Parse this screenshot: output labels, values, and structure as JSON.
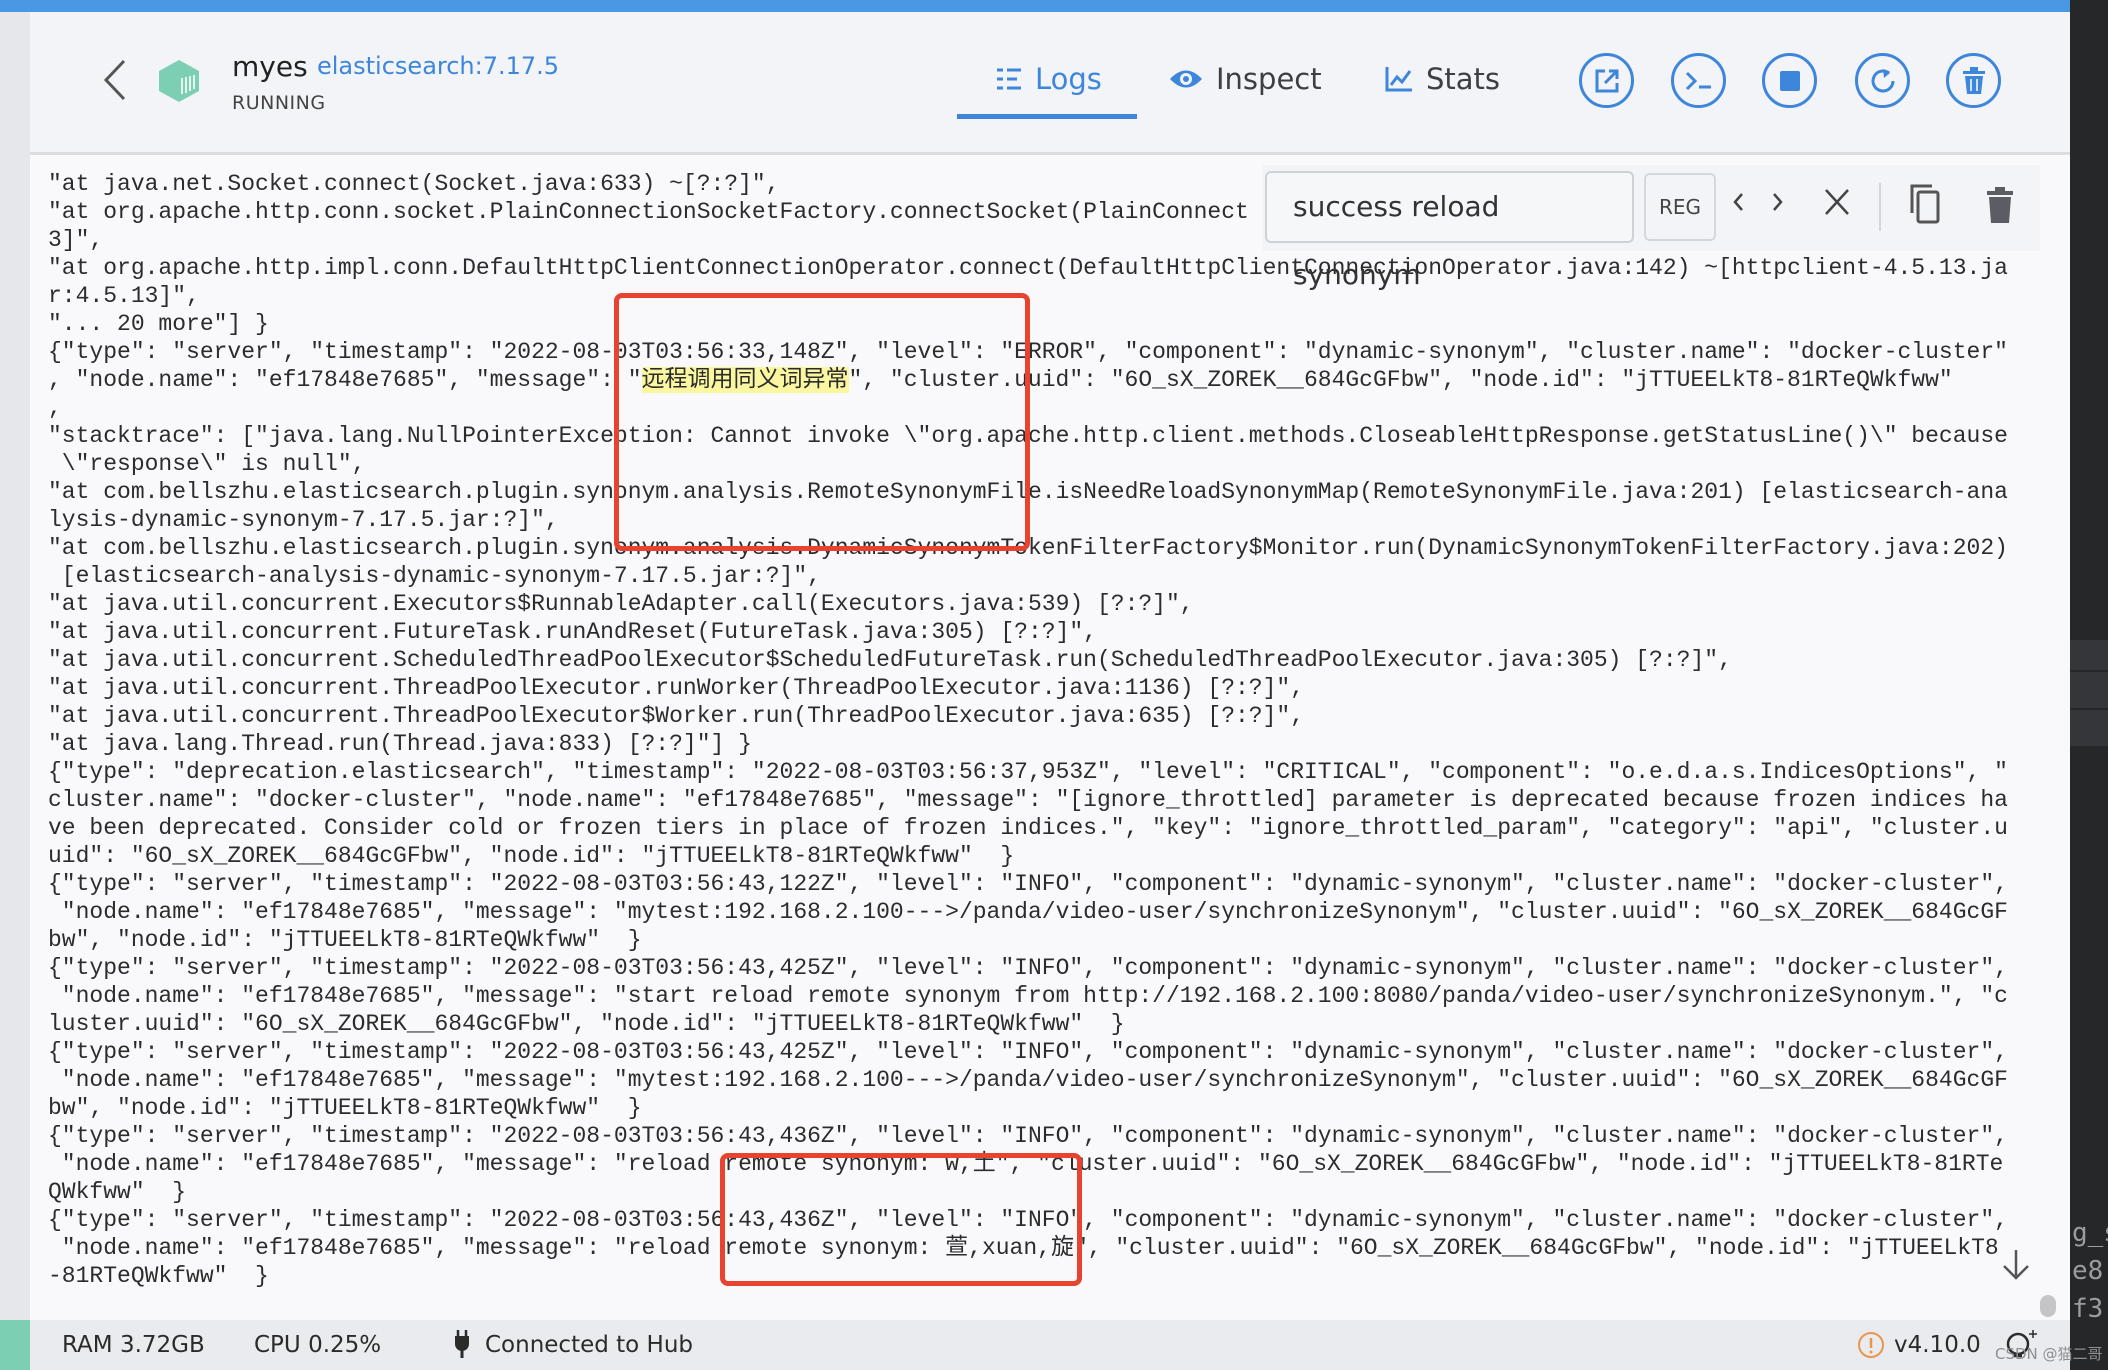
{
  "header": {
    "container_name": "myes",
    "image": "elasticsearch:7.17.5",
    "status": "RUNNING",
    "tabs": [
      {
        "label": "Logs",
        "icon": "list-icon",
        "active": true
      },
      {
        "label": "Inspect",
        "icon": "eye-icon",
        "active": false
      },
      {
        "label": "Stats",
        "icon": "chart-icon",
        "active": false
      }
    ],
    "actions": [
      "open-in-browser",
      "cli",
      "stop",
      "restart",
      "delete"
    ]
  },
  "search": {
    "query": "success reload synonym",
    "regex_label": "REG"
  },
  "logs": [
    {
      "t": "\"at java.net.Socket.connect(Socket.java:633) ~[?:?]\","
    },
    {
      "t": "\"at org.apache.http.conn.socket.PlainConnectionSocketFactory.connectSocket(PlainConnect"
    },
    {
      "t": "3]\","
    },
    {
      "t": "\"at org.apache.http.impl.conn.DefaultHttpClientConnectionOperator.connect(DefaultHttpClientConnectionOperator.java:142) ~[httpclient-4.5.13.ja"
    },
    {
      "t": "r:4.5.13]\","
    },
    {
      "t": "\"... 20 more\"] }"
    },
    {
      "t": "{\"type\": \"server\", \"timestamp\": \"2022-08-03T03:56:33,148Z\", \"level\": \"ERROR\", \"component\": \"dynamic-synonym\", \"cluster.name\": \"docker-cluster\""
    },
    {
      "t": ", \"node.name\": \"ef17848e7685\", \"message\": \"",
      "hl": "远程调用同义词异常",
      "t2": "\", \"cluster.uuid\": \"6O_sX_ZOREK__684GcGFbw\", \"node.id\": \"jTTUEELkT8-81RTeQWkfww\""
    },
    {
      "t": ","
    },
    {
      "t": "\"stacktrace\": [\"java.lang.NullPointerException: Cannot invoke \\\"org.apache.http.client.methods.CloseableHttpResponse.getStatusLine()\\\" because"
    },
    {
      "t": " \\\"response\\\" is null\","
    },
    {
      "t": "\"at com.bellszhu.elasticsearch.plugin.synonym.analysis.RemoteSynonymFile.isNeedReloadSynonymMap(RemoteSynonymFile.java:201) [elasticsearch-ana"
    },
    {
      "t": "lysis-dynamic-synonym-7.17.5.jar:?]\","
    },
    {
      "t": "\"at com.bellszhu.elasticsearch.plugin.synonym.analysis.DynamicSynonymTokenFilterFactory$Monitor.run(DynamicSynonymTokenFilterFactory.java:202)"
    },
    {
      "t": " [elasticsearch-analysis-dynamic-synonym-7.17.5.jar:?]\","
    },
    {
      "t": "\"at java.util.concurrent.Executors$RunnableAdapter.call(Executors.java:539) [?:?]\","
    },
    {
      "t": "\"at java.util.concurrent.FutureTask.runAndReset(FutureTask.java:305) [?:?]\","
    },
    {
      "t": "\"at java.util.concurrent.ScheduledThreadPoolExecutor$ScheduledFutureTask.run(ScheduledThreadPoolExecutor.java:305) [?:?]\","
    },
    {
      "t": "\"at java.util.concurrent.ThreadPoolExecutor.runWorker(ThreadPoolExecutor.java:1136) [?:?]\","
    },
    {
      "t": "\"at java.util.concurrent.ThreadPoolExecutor$Worker.run(ThreadPoolExecutor.java:635) [?:?]\","
    },
    {
      "t": "\"at java.lang.Thread.run(Thread.java:833) [?:?]\"] }"
    },
    {
      "t": "{\"type\": \"deprecation.elasticsearch\", \"timestamp\": \"2022-08-03T03:56:37,953Z\", \"level\": \"CRITICAL\", \"component\": \"o.e.d.a.s.IndicesOptions\", \""
    },
    {
      "t": "cluster.name\": \"docker-cluster\", \"node.name\": \"ef17848e7685\", \"message\": \"[ignore_throttled] parameter is deprecated because frozen indices ha"
    },
    {
      "t": "ve been deprecated. Consider cold or frozen tiers in place of frozen indices.\", \"key\": \"ignore_throttled_param\", \"category\": \"api\", \"cluster.u"
    },
    {
      "t": "uid\": \"6O_sX_ZOREK__684GcGFbw\", \"node.id\": \"jTTUEELkT8-81RTeQWkfww\"  }"
    },
    {
      "t": "{\"type\": \"server\", \"timestamp\": \"2022-08-03T03:56:43,122Z\", \"level\": \"INFO\", \"component\": \"dynamic-synonym\", \"cluster.name\": \"docker-cluster\","
    },
    {
      "t": " \"node.name\": \"ef17848e7685\", \"message\": \"mytest:192.168.2.100--->/panda/video-user/synchronizeSynonym\", \"cluster.uuid\": \"6O_sX_ZOREK__684GcGF"
    },
    {
      "t": "bw\", \"node.id\": \"jTTUEELkT8-81RTeQWkfww\"  }"
    },
    {
      "t": "{\"type\": \"server\", \"timestamp\": \"2022-08-03T03:56:43,425Z\", \"level\": \"INFO\", \"component\": \"dynamic-synonym\", \"cluster.name\": \"docker-cluster\","
    },
    {
      "t": " \"node.name\": \"ef17848e7685\", \"message\": \"start reload remote synonym from http://192.168.2.100:8080/panda/video-user/synchronizeSynonym.\", \"c"
    },
    {
      "t": "luster.uuid\": \"6O_sX_ZOREK__684GcGFbw\", \"node.id\": \"jTTUEELkT8-81RTeQWkfww\"  }"
    },
    {
      "t": "{\"type\": \"server\", \"timestamp\": \"2022-08-03T03:56:43,425Z\", \"level\": \"INFO\", \"component\": \"dynamic-synonym\", \"cluster.name\": \"docker-cluster\","
    },
    {
      "t": " \"node.name\": \"ef17848e7685\", \"message\": \"mytest:192.168.2.100--->/panda/video-user/synchronizeSynonym\", \"cluster.uuid\": \"6O_sX_ZOREK__684GcGF"
    },
    {
      "t": "bw\", \"node.id\": \"jTTUEELkT8-81RTeQWkfww\"  }"
    },
    {
      "t": "{\"type\": \"server\", \"timestamp\": \"2022-08-03T03:56:43,436Z\", \"level\": \"INFO\", \"component\": \"dynamic-synonym\", \"cluster.name\": \"docker-cluster\","
    },
    {
      "t": " \"node.name\": \"ef17848e7685\", \"message\": \"reload remote synonym: w,土\", \"cluster.uuid\": \"6O_sX_ZOREK__684GcGFbw\", \"node.id\": \"jTTUEELkT8-81RTe"
    },
    {
      "t": "QWkfww\"  }"
    },
    {
      "t": "{\"type\": \"server\", \"timestamp\": \"2022-08-03T03:56:43,436Z\", \"level\": \"INFO\", \"component\": \"dynamic-synonym\", \"cluster.name\": \"docker-cluster\","
    },
    {
      "t": " \"node.name\": \"ef17848e7685\", \"message\": \"reload remote synonym: 萱,xuan,旋\", \"cluster.uuid\": \"6O_sX_ZOREK__684GcGFbw\", \"node.id\": \"jTTUEELkT8"
    },
    {
      "t": "-81RTeQWkfww\"  }"
    }
  ],
  "statusbar": {
    "ram": "RAM 3.72GB",
    "cpu": "CPU 0.25%",
    "hub": "Connected to Hub",
    "version": "v4.10.0"
  },
  "background_window_text": [
    "g_s",
    "e8",
    "f3"
  ],
  "watermark": "CSDN @猫二哥",
  "colors": {
    "accent": "#3d86db",
    "topbar": "#4a97e3",
    "annotation_box": "#e8432e",
    "highlight": "#fbf6a0",
    "running_green": "#7dcfb3",
    "warning": "#e8964a"
  }
}
